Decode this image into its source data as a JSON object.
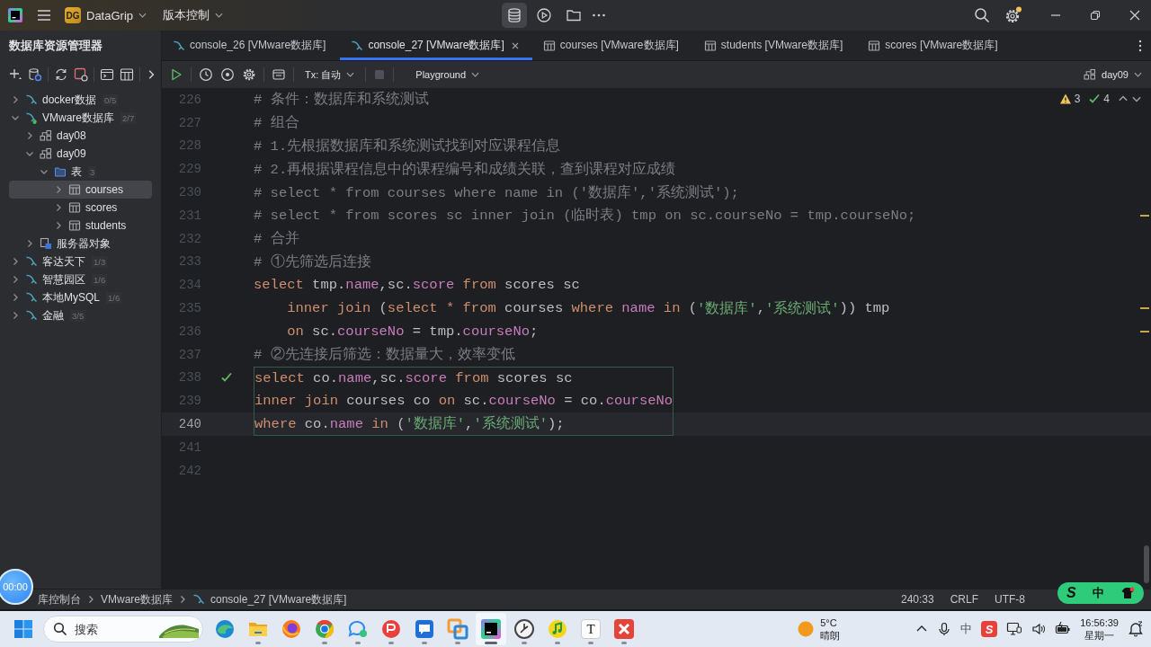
{
  "title_bar": {
    "project_badge": "DG",
    "project": "DataGrip",
    "vcs": "版本控制",
    "tool_windows": [
      {
        "kind": "database",
        "selected": true
      },
      {
        "kind": "run",
        "selected": false
      },
      {
        "kind": "folder",
        "selected": false
      }
    ]
  },
  "sidebar": {
    "title": "数据库资源管理器",
    "tree": [
      {
        "label": "docker数据",
        "count": "0/5",
        "kind": "datasource",
        "connected": false,
        "expanded": false,
        "selected": false
      },
      {
        "label": "VMware数据库",
        "count": "2/7",
        "kind": "datasource",
        "connected": true,
        "expanded": true,
        "selected": false,
        "children": [
          {
            "label": "day08",
            "kind": "schema",
            "expanded": false,
            "selected": false
          },
          {
            "label": "day09",
            "kind": "schema",
            "expanded": true,
            "selected": false,
            "children": [
              {
                "label": "表",
                "count": "3",
                "kind": "folder",
                "expanded": true,
                "selected": false,
                "children": [
                  {
                    "label": "courses",
                    "kind": "table",
                    "expanded": false,
                    "selected": true
                  },
                  {
                    "label": "scores",
                    "kind": "table",
                    "expanded": false,
                    "selected": false
                  },
                  {
                    "label": "students",
                    "kind": "table",
                    "expanded": false,
                    "selected": false
                  }
                ]
              }
            ]
          },
          {
            "label": "服务器对象",
            "kind": "server_objects",
            "expanded": false,
            "selected": false
          }
        ]
      },
      {
        "label": "客达天下",
        "count": "1/3",
        "kind": "datasource",
        "connected": false,
        "expanded": false,
        "selected": false
      },
      {
        "label": "智慧园区",
        "count": "1/6",
        "kind": "datasource",
        "connected": false,
        "expanded": false,
        "selected": false
      },
      {
        "label": "本地MySQL",
        "count": "1/6",
        "kind": "datasource",
        "connected": false,
        "expanded": false,
        "selected": false
      },
      {
        "label": "金融",
        "count": "3/5",
        "kind": "datasource",
        "connected": false,
        "expanded": false,
        "selected": false
      }
    ]
  },
  "tabs": [
    {
      "label": "console_26 [VMware数据库]",
      "kind": "console",
      "selected": false
    },
    {
      "label": "console_27 [VMware数据库]",
      "kind": "console",
      "selected": true
    },
    {
      "label": "courses [VMware数据库]",
      "kind": "table",
      "selected": false
    },
    {
      "label": "students [VMware数据库]",
      "kind": "table",
      "selected": false
    },
    {
      "label": "scores [VMware数据库]",
      "kind": "table",
      "selected": false
    }
  ],
  "editor_toolbar": {
    "transaction": "Tx: 自动",
    "session": "Playground",
    "schema": "day09"
  },
  "inspections": {
    "warnings": "3",
    "passed": "4"
  },
  "editor": {
    "lines": [
      {
        "number": "226",
        "current": false,
        "statement": false,
        "check": false,
        "warning": false,
        "tokens": [
          {
            "text": "# 条件：数据库和系统测试",
            "kind": "comment"
          }
        ]
      },
      {
        "number": "227",
        "current": false,
        "statement": false,
        "check": false,
        "warning": false,
        "tokens": [
          {
            "text": "# 组合",
            "kind": "comment"
          }
        ]
      },
      {
        "number": "228",
        "current": false,
        "statement": false,
        "check": false,
        "warning": false,
        "tokens": [
          {
            "text": "# 1.先根据数据库和系统测试找到对应课程信息",
            "kind": "comment"
          }
        ]
      },
      {
        "number": "229",
        "current": false,
        "statement": false,
        "check": false,
        "warning": false,
        "tokens": [
          {
            "text": "# 2.再根据课程信息中的课程编号和成绩关联，查到课程对应成绩",
            "kind": "comment"
          }
        ]
      },
      {
        "number": "230",
        "current": false,
        "statement": false,
        "check": false,
        "warning": false,
        "tokens": [
          {
            "text": "# select * from courses where name in ('数据库','系统测试');",
            "kind": "comment"
          }
        ]
      },
      {
        "number": "231",
        "current": false,
        "statement": false,
        "check": false,
        "warning": true,
        "tokens": [
          {
            "text": "# select * from scores sc inner join (临时表) tmp on sc.courseNo = tmp.courseNo;",
            "kind": "comment"
          }
        ]
      },
      {
        "number": "232",
        "current": false,
        "statement": false,
        "check": false,
        "warning": false,
        "tokens": [
          {
            "text": "# 合并",
            "kind": "comment"
          }
        ]
      },
      {
        "number": "233",
        "current": false,
        "statement": false,
        "check": false,
        "warning": false,
        "tokens": [
          {
            "text": "# ①先筛选后连接",
            "kind": "comment"
          }
        ]
      },
      {
        "number": "234",
        "current": false,
        "statement": false,
        "check": false,
        "warning": false,
        "tokens": [
          {
            "text": "select",
            "kind": "keyword"
          },
          {
            "text": " tmp.",
            "kind": "plain"
          },
          {
            "text": "name",
            "kind": "field"
          },
          {
            "text": ",sc.",
            "kind": "plain"
          },
          {
            "text": "score",
            "kind": "field"
          },
          {
            "text": " from",
            "kind": "keyword"
          },
          {
            "text": " scores sc",
            "kind": "plain"
          }
        ]
      },
      {
        "number": "235",
        "current": false,
        "statement": false,
        "check": false,
        "warning": true,
        "tokens": [
          {
            "text": "    inner join",
            "kind": "keyword"
          },
          {
            "text": " (",
            "kind": "plain"
          },
          {
            "text": "select",
            "kind": "keyword"
          },
          {
            "text": " *",
            "kind": "keyword"
          },
          {
            "text": " from",
            "kind": "keyword"
          },
          {
            "text": " courses ",
            "kind": "plain"
          },
          {
            "text": "where",
            "kind": "keyword"
          },
          {
            "text": " name",
            "kind": "field"
          },
          {
            "text": " in",
            "kind": "keyword"
          },
          {
            "text": " (",
            "kind": "plain"
          },
          {
            "text": "'数据库'",
            "kind": "string"
          },
          {
            "text": ",",
            "kind": "plain"
          },
          {
            "text": "'系统测试'",
            "kind": "string"
          },
          {
            "text": ")) tmp",
            "kind": "plain"
          }
        ]
      },
      {
        "number": "236",
        "current": false,
        "statement": false,
        "check": false,
        "warning": true,
        "tokens": [
          {
            "text": "    on",
            "kind": "keyword"
          },
          {
            "text": " sc.",
            "kind": "plain"
          },
          {
            "text": "courseNo",
            "kind": "field"
          },
          {
            "text": " = tmp.",
            "kind": "plain"
          },
          {
            "text": "courseNo",
            "kind": "field"
          },
          {
            "text": ";",
            "kind": "plain"
          }
        ]
      },
      {
        "number": "237",
        "current": false,
        "statement": false,
        "check": false,
        "warning": false,
        "tokens": [
          {
            "text": "# ②先连接后筛选：数据量大，效率变低",
            "kind": "comment"
          }
        ]
      },
      {
        "number": "238",
        "current": false,
        "statement": true,
        "check": true,
        "warning": false,
        "tokens": [
          {
            "text": "select",
            "kind": "keyword"
          },
          {
            "text": " co.",
            "kind": "plain"
          },
          {
            "text": "name",
            "kind": "field"
          },
          {
            "text": ",sc.",
            "kind": "plain"
          },
          {
            "text": "score",
            "kind": "field"
          },
          {
            "text": " from",
            "kind": "keyword"
          },
          {
            "text": " scores sc",
            "kind": "plain"
          }
        ]
      },
      {
        "number": "239",
        "current": false,
        "statement": true,
        "check": false,
        "warning": false,
        "tokens": [
          {
            "text": "inner join",
            "kind": "keyword"
          },
          {
            "text": " courses co ",
            "kind": "plain"
          },
          {
            "text": "on",
            "kind": "keyword"
          },
          {
            "text": " sc.",
            "kind": "plain"
          },
          {
            "text": "courseNo",
            "kind": "field"
          },
          {
            "text": " = co.",
            "kind": "plain"
          },
          {
            "text": "courseNo",
            "kind": "field"
          }
        ]
      },
      {
        "number": "240",
        "current": true,
        "statement": true,
        "check": false,
        "warning": false,
        "tokens": [
          {
            "text": "where",
            "kind": "keyword"
          },
          {
            "text": " co.",
            "kind": "plain"
          },
          {
            "text": "name",
            "kind": "field"
          },
          {
            "text": " in",
            "kind": "keyword"
          },
          {
            "text": " (",
            "kind": "plain"
          },
          {
            "text": "'数据库'",
            "kind": "string"
          },
          {
            "text": ",",
            "kind": "plain"
          },
          {
            "text": "'系统测试'",
            "kind": "string"
          },
          {
            "text": ");",
            "kind": "plain"
          }
        ]
      },
      {
        "number": "241",
        "current": false,
        "statement": false,
        "check": false,
        "warning": false
      },
      {
        "number": "242",
        "current": false,
        "statement": false,
        "check": false,
        "warning": false
      }
    ]
  },
  "status_bar": {
    "breadcrumbs": [
      {
        "label": "库控制台",
        "kind": "plain"
      },
      {
        "label": "VMware数据库",
        "kind": "plain"
      },
      {
        "label": "console_27 [VMware数据库]",
        "kind": "console"
      }
    ],
    "position": "240:33",
    "line_separator": "CRLF",
    "encoding": "UTF-8"
  },
  "ime_widget": {
    "logo": "S",
    "mode": "中"
  },
  "recording_timer": "00:00",
  "taskbar": {
    "search_placeholder": "搜索",
    "apps": [
      {
        "kind": "swirl",
        "running": false,
        "active": false
      },
      {
        "kind": "folder",
        "running": true,
        "active": false
      },
      {
        "kind": "fox",
        "running": false,
        "active": false
      },
      {
        "kind": "ring",
        "running": true,
        "active": false
      },
      {
        "kind": "chat",
        "running": true,
        "active": false
      },
      {
        "kind": "disc",
        "running": true,
        "active": false
      },
      {
        "kind": "message",
        "running": true,
        "active": false
      },
      {
        "kind": "squares",
        "running": true,
        "active": false
      },
      {
        "kind": "ide",
        "running": true,
        "active": true
      },
      {
        "kind": "clock",
        "running": true,
        "active": false
      },
      {
        "kind": "note",
        "running": true,
        "active": false
      },
      {
        "kind": "glyph",
        "glyph": "T",
        "running": true,
        "active": false
      },
      {
        "kind": "cross",
        "running": true,
        "active": false
      }
    ],
    "weather": {
      "temperature": "5°C",
      "condition": "晴朗"
    },
    "tray_ime": "中",
    "tray_logo": "S",
    "time": "16:56:39",
    "day": "星期一"
  }
}
